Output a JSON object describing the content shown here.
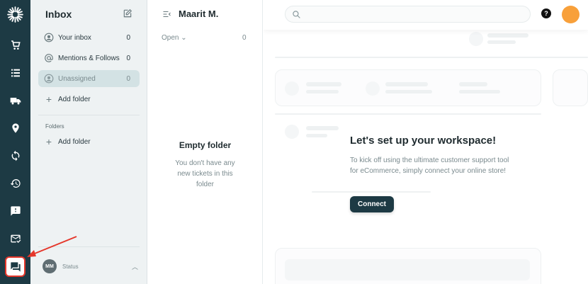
{
  "sidebar": {
    "items": [
      {
        "name": "cart-icon"
      },
      {
        "name": "list-icon"
      },
      {
        "name": "truck-icon"
      },
      {
        "name": "location-icon"
      },
      {
        "name": "refresh-icon"
      },
      {
        "name": "history-icon"
      },
      {
        "name": "alert-icon"
      },
      {
        "name": "mail-check-icon"
      },
      {
        "name": "chat-icon",
        "active": true
      }
    ]
  },
  "folders": {
    "title": "Inbox",
    "items": [
      {
        "label": "Your inbox",
        "count": "0",
        "icon": "user-icon"
      },
      {
        "label": "Mentions & Follows",
        "count": "0",
        "icon": "at-icon"
      },
      {
        "label": "Unassigned",
        "count": "0",
        "icon": "user-icon",
        "selected": true
      }
    ],
    "add_folder": "Add folder",
    "section_label": "Folders",
    "section_add": "Add folder",
    "user_initials": "MM",
    "user_status": "Status"
  },
  "tickets": {
    "agent_name": "Maarit M.",
    "filter": "Open",
    "filter_count": "0",
    "empty_title": "Empty folder",
    "empty_desc": "You don't have any new tickets in this folder"
  },
  "main": {
    "setup_title": "Let's set up your workspace!",
    "setup_desc": "To kick off using the ultimate customer support tool for eCommerce, simply connect your online store!",
    "connect_label": "Connect",
    "help_label": "?"
  },
  "colors": {
    "rail": "#1d3a44",
    "accent": "#1d3a44",
    "profile": "#f8a03a",
    "highlight": "#e5372b"
  }
}
